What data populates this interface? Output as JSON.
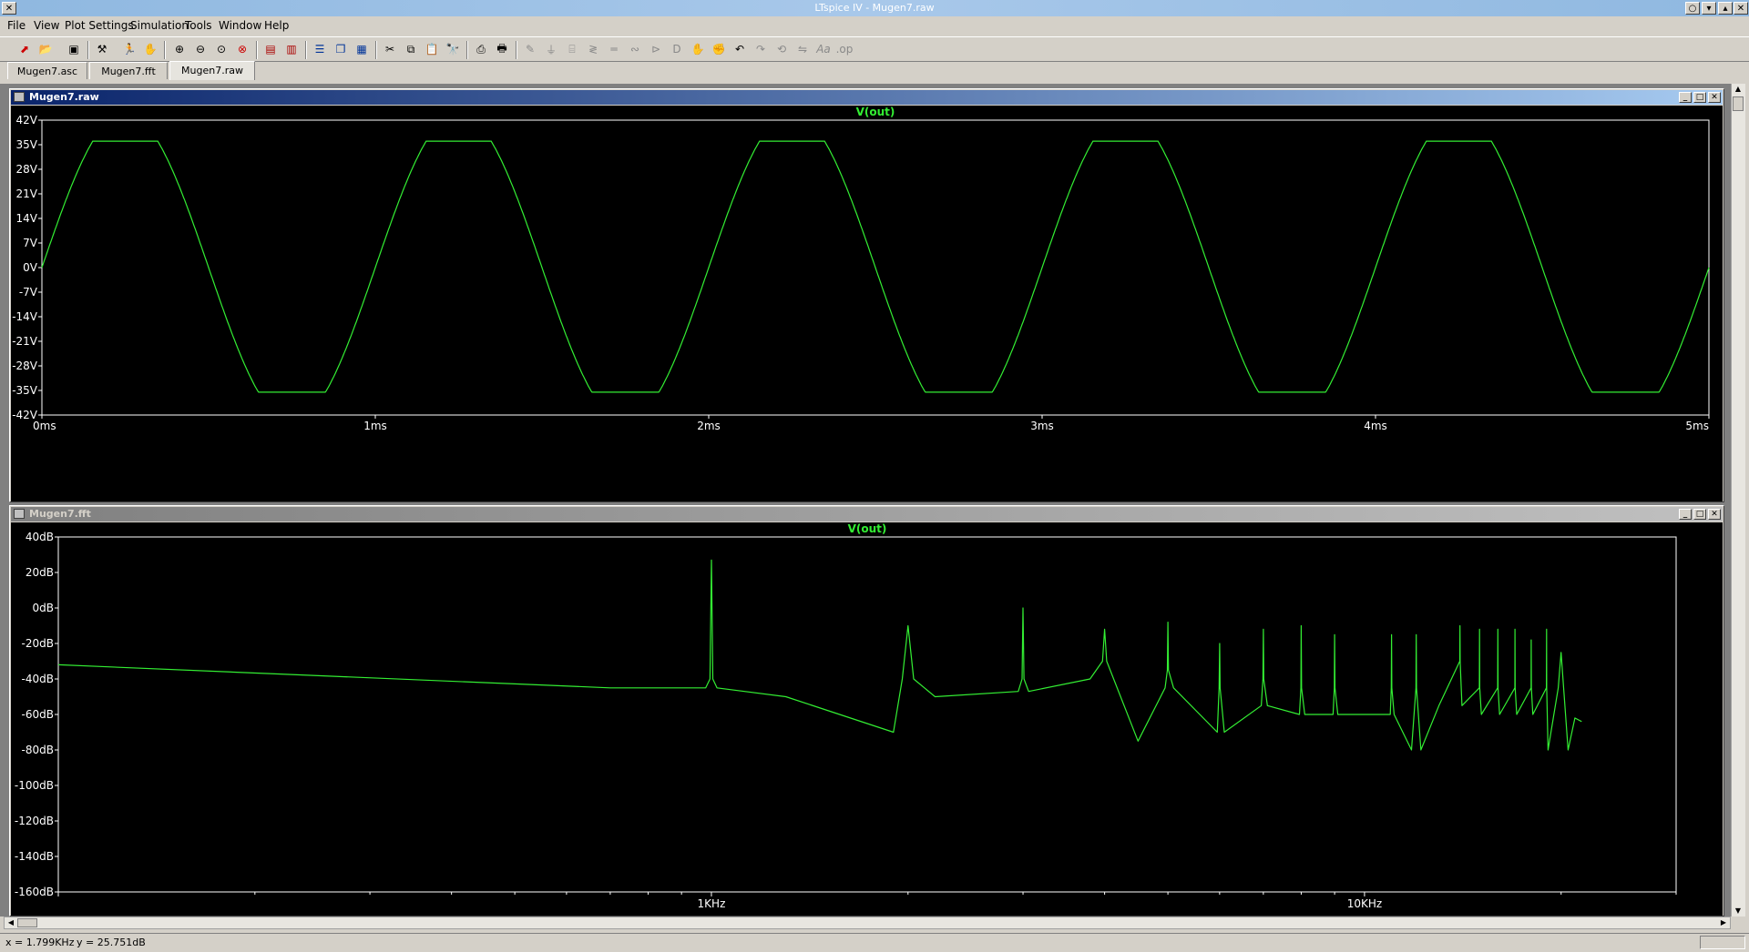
{
  "app": {
    "title": "LTspice IV - Mugen7.raw"
  },
  "menu": [
    "File",
    "View",
    "Plot Settings",
    "Simulation",
    "Tools",
    "Window",
    "Help"
  ],
  "tabs": [
    "Mugen7.asc",
    "Mugen7.fft",
    "Mugen7.raw"
  ],
  "active_tab": "Mugen7.raw",
  "toolbar_icons": [
    "new-schematic-icon",
    "open-icon",
    "save-icon",
    "control-panel-icon",
    "run-icon",
    "halt-icon",
    "zoom-in-icon",
    "zoom-out-icon",
    "zoom-fit-icon",
    "zoom-cancel-icon",
    "autorange-icon",
    "edit-window-icon",
    "tile-horizontal-icon",
    "cascade-icon",
    "tile-vertical-icon",
    "cut-icon",
    "copy-icon",
    "paste-icon",
    "find-icon",
    "print-preview-icon",
    "print-icon",
    "wire-icon",
    "ground-icon",
    "label-icon",
    "resistor-icon",
    "capacitor-icon",
    "inductor-icon",
    "diode-icon",
    "component-icon",
    "move-icon",
    "drag-icon",
    "undo-icon",
    "redo-icon",
    "rotate-icon",
    "mirror-icon",
    "text-icon",
    "spice-directive-icon"
  ],
  "windows": {
    "raw": {
      "title": "Mugen7.raw"
    },
    "fft": {
      "title": "Mugen7.fft"
    }
  },
  "status": {
    "x_readout": "x = 1.799KHz",
    "y_readout": "y = 25.751dB"
  },
  "colors": {
    "trace": "#33ee33",
    "plot_bg": "#000000",
    "grid": "#ffffff",
    "active_title": "#0a246a"
  },
  "chart_data": [
    {
      "type": "line",
      "title": "V(out)",
      "xlabel": "",
      "ylabel": "",
      "x_unit": "ms",
      "xlim": [
        0,
        5
      ],
      "ylim": [
        -42,
        42
      ],
      "x_ticks": [
        "0ms",
        "1ms",
        "2ms",
        "3ms",
        "4ms",
        "5ms"
      ],
      "y_ticks": [
        "42V",
        "35V",
        "28V",
        "21V",
        "14V",
        "7V",
        "0V",
        "-7V",
        "-14V",
        "-21V",
        "-28V",
        "-35V",
        "-42V"
      ],
      "grid": false,
      "series": [
        {
          "name": "V(out)",
          "frequency_khz": 1,
          "amplitude_v": 44,
          "clip_high_v": 36,
          "clip_low_v": -35.5
        }
      ]
    },
    {
      "type": "line",
      "title": "V(out)",
      "xlabel": "",
      "ylabel": "",
      "x_scale": "log",
      "x_ticks": [
        "1KHz",
        "10KHz"
      ],
      "xlim_hz": [
        100,
        30000
      ],
      "ylim": [
        -160,
        40
      ],
      "y_ticks": [
        "40dB",
        "20dB",
        "0dB",
        "-20dB",
        "-40dB",
        "-60dB",
        "-80dB",
        "-100dB",
        "-120dB",
        "-140dB",
        "-160dB"
      ],
      "grid": false,
      "series": [
        {
          "name": "V(out)",
          "x_hz": [
            100,
            700,
            980,
            995,
            1000,
            1005,
            1020,
            1300,
            1900,
            1960,
            2000,
            2040,
            2200,
            2950,
            2990,
            3000,
            3010,
            3060,
            3800,
            3970,
            4000,
            4030,
            4500,
            4950,
            4990,
            5000,
            5010,
            5100,
            5950,
            5990,
            6000,
            6010,
            6100,
            6950,
            6990,
            7000,
            7010,
            7100,
            7950,
            7990,
            8000,
            8010,
            8100,
            8950,
            8990,
            9000,
            9010,
            9100,
            10950,
            10990,
            11000,
            11010,
            11100,
            11800,
            11990,
            12000,
            12010,
            12200,
            13000,
            13990,
            14000,
            14010,
            14100,
            14990,
            15000,
            15010,
            15100,
            15990,
            16000,
            16010,
            16100,
            16990,
            17000,
            17010,
            17100,
            17990,
            18000,
            18010,
            18100,
            18990,
            19000,
            19010,
            19100,
            19800,
            20000,
            20500,
            21000,
            21500
          ],
          "y_db": [
            -32,
            -45,
            -45,
            -40,
            27,
            -40,
            -45,
            -50,
            -70,
            -40,
            -10,
            -40,
            -50,
            -47,
            -40,
            0,
            -40,
            -47,
            -40,
            -30,
            -12,
            -30,
            -75,
            -45,
            -35,
            -8,
            -35,
            -45,
            -70,
            -45,
            -20,
            -45,
            -70,
            -55,
            -40,
            -12,
            -40,
            -55,
            -60,
            -45,
            -10,
            -45,
            -60,
            -60,
            -45,
            -15,
            -45,
            -60,
            -60,
            -45,
            -15,
            -45,
            -60,
            -80,
            -45,
            -15,
            -45,
            -80,
            -55,
            -30,
            -10,
            -30,
            -55,
            -45,
            -12,
            -45,
            -60,
            -45,
            -12,
            -45,
            -60,
            -45,
            -12,
            -45,
            -60,
            -45,
            -18,
            -45,
            -60,
            -45,
            -12,
            -45,
            -80,
            -45,
            -25,
            -80,
            -62,
            -64
          ]
        }
      ]
    }
  ]
}
